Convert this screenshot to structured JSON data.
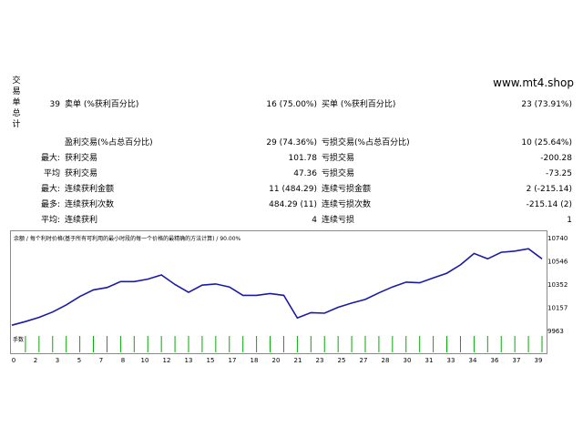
{
  "side_label": [
    "交",
    "易",
    "单",
    "总",
    "计"
  ],
  "site": "www.mt4.shop",
  "rows": [
    {
      "c1": "39",
      "c2": "卖单 (%获利百分比)",
      "c3": "16 (75.00%)",
      "c4": "买单 (%获利百分比)",
      "c5": "23 (73.91%)"
    },
    {
      "c1": "",
      "c2": "盈利交易(%占总百分比)",
      "c3": "29 (74.36%)",
      "c4": "亏损交易(%占总百分比)",
      "c5": "10 (25.64%)"
    },
    {
      "c1": "最大:",
      "c2": "获利交易",
      "c3": "101.78",
      "c4": "亏损交易",
      "c5": "-200.28"
    },
    {
      "c1": "平均",
      "c2": "获利交易",
      "c3": "47.36",
      "c4": "亏损交易",
      "c5": "-73.25"
    },
    {
      "c1": "最大:",
      "c2": "连续获利金额",
      "c3": "11 (484.29)",
      "c4": "连续亏损金额",
      "c5": "2 (-215.14)"
    },
    {
      "c1": "最多:",
      "c2": "连续获利次数",
      "c3": "484.29 (11)",
      "c4": "连续亏损次数",
      "c5": "-215.14 (2)"
    },
    {
      "c1": "平均:",
      "c2": "连续获利",
      "c3": "4",
      "c4": "连续亏损",
      "c5": "1"
    }
  ],
  "chart_data": {
    "type": "line",
    "title": "余额 / 每个利时价格(基于所有可利用的最小时段的每一个价格的最精确的方法计算) / 90.00%",
    "volume_label": "手数",
    "x_ticks": [
      "0",
      "2",
      "3",
      "5",
      "7",
      "8",
      "10",
      "12",
      "13",
      "15",
      "17",
      "18",
      "20",
      "21",
      "23",
      "25",
      "27",
      "28",
      "30",
      "31",
      "33",
      "34",
      "36",
      "37",
      "39"
    ],
    "y_ticks": [
      "10740",
      "10546",
      "10352",
      "10157",
      "9963"
    ],
    "ylim": [
      9963,
      10740
    ],
    "series": [
      {
        "x": [
          0,
          1,
          2,
          3,
          4,
          5,
          6,
          7,
          8,
          9,
          10,
          11,
          12,
          13,
          14,
          15,
          16,
          17,
          18,
          19,
          20,
          21,
          22,
          23,
          24,
          25,
          26,
          27,
          28,
          29,
          30,
          31,
          32,
          33,
          34,
          35,
          36,
          37,
          38,
          39
        ],
        "values": [
          10015,
          10045,
          10080,
          10125,
          10185,
          10255,
          10310,
          10330,
          10380,
          10380,
          10400,
          10435,
          10355,
          10290,
          10350,
          10360,
          10335,
          10265,
          10265,
          10280,
          10265,
          10075,
          10120,
          10115,
          10165,
          10200,
          10230,
          10285,
          10335,
          10375,
          10370,
          10410,
          10450,
          10520,
          10615,
          10570,
          10625,
          10635,
          10655,
          10570
        ]
      }
    ],
    "line_color": "#1a1aa8",
    "grid": false
  }
}
